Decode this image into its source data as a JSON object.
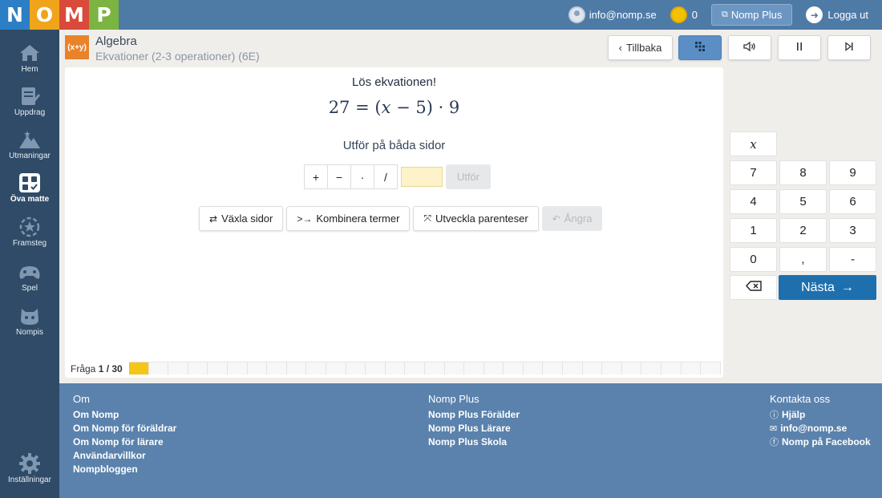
{
  "logo": {
    "letters": [
      {
        "char": "N",
        "color": "#2c7fc4"
      },
      {
        "char": "O",
        "color": "#f0a41a"
      },
      {
        "char": "M",
        "color": "#d94a3b"
      },
      {
        "char": "P",
        "color": "#7bb441"
      }
    ]
  },
  "topbar": {
    "email": "info@nomp.se",
    "coins": "0",
    "plus_label": "Nomp Plus",
    "logout_label": "Logga ut"
  },
  "sidebar": {
    "items": [
      {
        "label": "Hem",
        "icon": "home-icon"
      },
      {
        "label": "Uppdrag",
        "icon": "assignment-icon"
      },
      {
        "label": "Utmaningar",
        "icon": "mountain-icon"
      },
      {
        "label": "Öva matte",
        "icon": "calculator-icon"
      },
      {
        "label": "Framsteg",
        "icon": "progress-star-icon"
      },
      {
        "label": "Spel",
        "icon": "gamepad-icon"
      },
      {
        "label": "Nompis",
        "icon": "nompis-icon"
      }
    ],
    "settings_label": "Inställningar"
  },
  "lesson": {
    "badge": "(x+y)",
    "title": "Algebra",
    "subtitle": "Ekvationer (2-3 operationer) (6E)"
  },
  "toolbar": {
    "back_label": "Tillbaka"
  },
  "question": {
    "title": "Lös ekvationen!",
    "eq_left": "27 = (",
    "eq_var": "x",
    "eq_right": " − 5) · 9",
    "instruction": "Utför på båda sidor",
    "operators": [
      "+",
      "−",
      "·",
      "/"
    ],
    "execute_label": "Utför"
  },
  "actions": {
    "swap": "Växla sidor",
    "combine": "Kombinera termer",
    "expand": "Utveckla parenteser",
    "undo": "Ångra"
  },
  "progress": {
    "prefix": "Fråga ",
    "current": "1 / 30",
    "answered": 1,
    "total": 30
  },
  "keypad": {
    "var": "x",
    "rows": [
      [
        "7",
        "8",
        "9"
      ],
      [
        "4",
        "5",
        "6"
      ],
      [
        "1",
        "2",
        "3"
      ],
      [
        "0",
        ",",
        "-"
      ]
    ],
    "next_label": "Nästa"
  },
  "footer": {
    "col1": {
      "heading": "Om",
      "links": [
        "Om Nomp",
        "Om Nomp för föräldrar",
        "Om Nomp för lärare",
        "Användarvillkor",
        "Nompbloggen"
      ]
    },
    "col2": {
      "heading": "Nomp Plus",
      "links": [
        "Nomp Plus Förälder",
        "Nomp Plus Lärare",
        "Nomp Plus Skola"
      ]
    },
    "col3": {
      "heading": "Kontakta oss",
      "links": [
        {
          "label": "Hjälp",
          "icon": "help-icon"
        },
        {
          "label": "info@nomp.se",
          "icon": "mail-icon"
        },
        {
          "label": "Nomp på Facebook",
          "icon": "facebook-icon"
        }
      ]
    }
  }
}
